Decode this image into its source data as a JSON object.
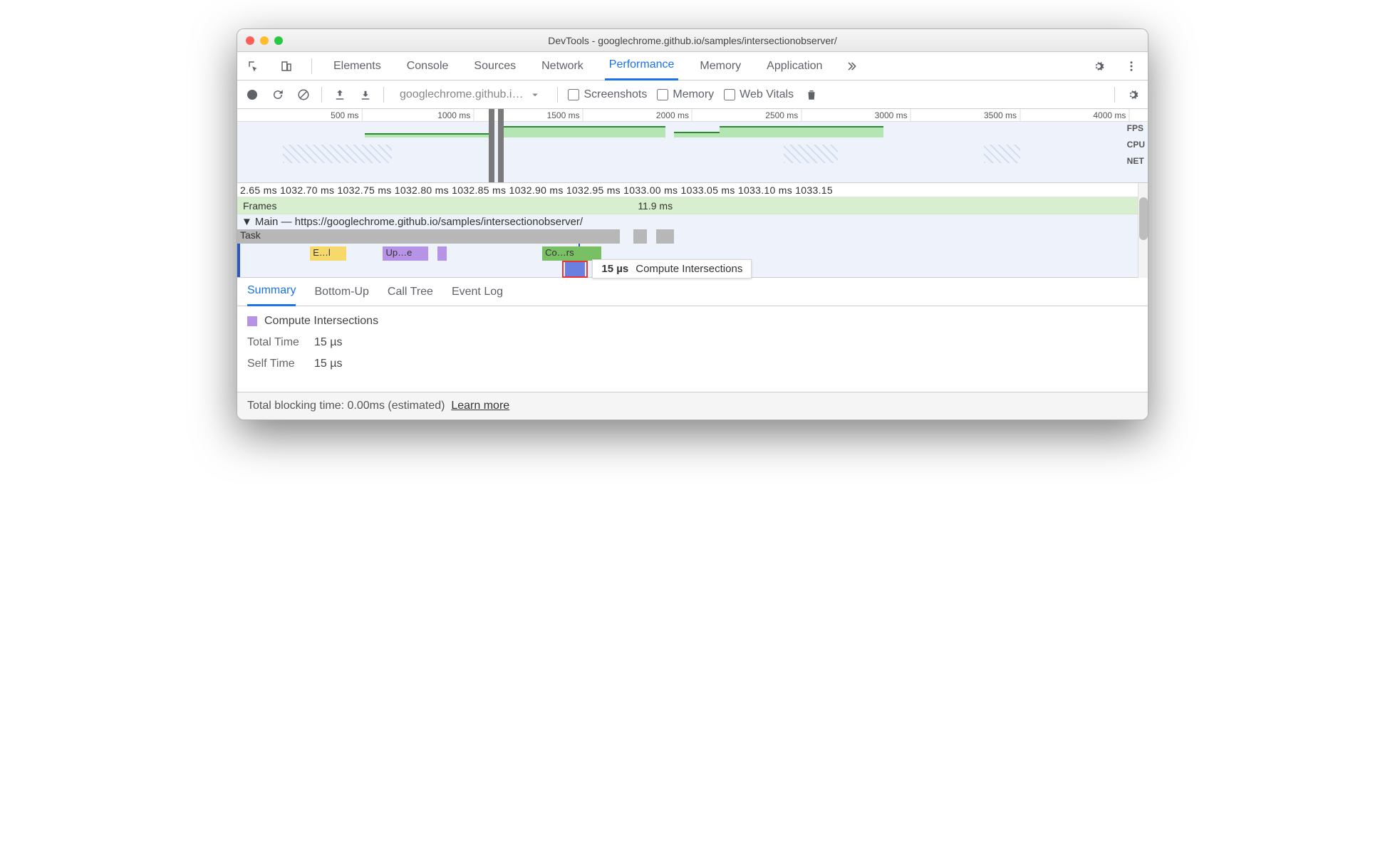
{
  "window": {
    "title": "DevTools - googlechrome.github.io/samples/intersectionobserver/"
  },
  "tabs": {
    "items": [
      "Elements",
      "Console",
      "Sources",
      "Network",
      "Performance",
      "Memory",
      "Application"
    ],
    "active_index": 4
  },
  "controls": {
    "dropdown_label": "googlechrome.github.i…",
    "checkboxes": {
      "screenshots": "Screenshots",
      "memory": "Memory",
      "web_vitals": "Web Vitals"
    }
  },
  "overview": {
    "ticks": [
      "500 ms",
      "1000 ms",
      "1500 ms",
      "2000 ms",
      "2500 ms",
      "3000 ms",
      "3500 ms",
      "4000 ms"
    ],
    "lanes": [
      "FPS",
      "CPU",
      "NET"
    ],
    "selection_left_pct": 27.6
  },
  "flame": {
    "fine_ticks": "2.65 ms 1032.70 ms 1032.75 ms 1032.80 ms 1032.85 ms 1032.90 ms 1032.95 ms 1033.00 ms 1033.05 ms 1033.10 ms 1033.15",
    "frames_label": "Frames",
    "frame_duration": "11.9 ms",
    "main_label": "Main — https://googlechrome.github.io/samples/intersectionobserver/",
    "task_label": "Task",
    "entries": {
      "e1": "E…l",
      "e2": "Up…e",
      "e3": "Co…rs"
    },
    "tooltip": {
      "dur": "15 µs",
      "name": "Compute Intersections"
    }
  },
  "detail_tabs": {
    "items": [
      "Summary",
      "Bottom-Up",
      "Call Tree",
      "Event Log"
    ],
    "active_index": 0
  },
  "summary": {
    "title": "Compute Intersections",
    "total_time_label": "Total Time",
    "total_time_value": "15 µs",
    "self_time_label": "Self Time",
    "self_time_value": "15 µs"
  },
  "footer": {
    "text": "Total blocking time: 0.00ms (estimated)",
    "link": "Learn more"
  }
}
